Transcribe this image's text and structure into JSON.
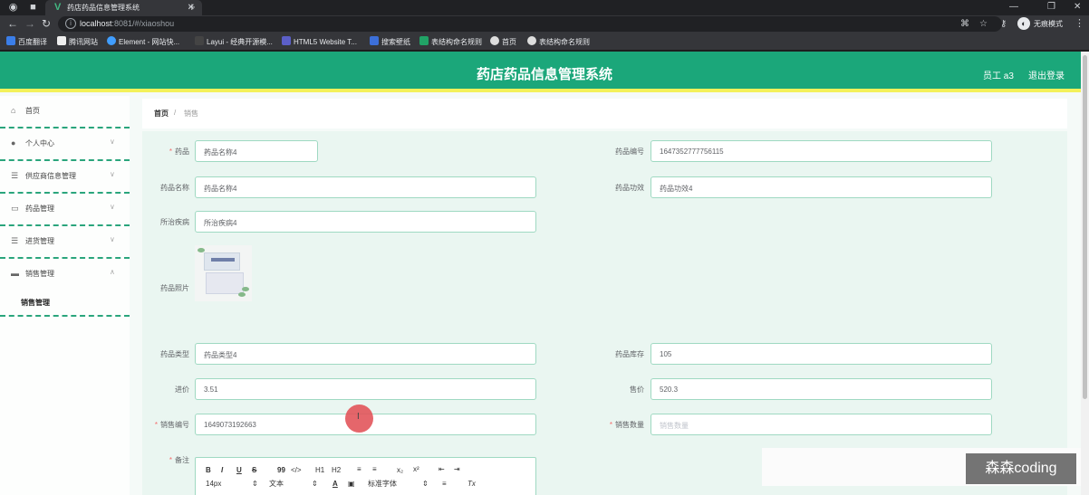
{
  "browser": {
    "tab_title": "药店药品信息管理系统",
    "tab_favicon": "vue-logo-icon",
    "url_host": "localhost",
    "url_rest": ":8081/#/xiaoshou",
    "profile_label": "无痕模式",
    "bookmarks": [
      "百度翻译",
      "腾讯网站",
      "Element - 网站快...",
      "Layui - 经典开源模...",
      "HTML5 Website T...",
      "搜索壁纸",
      "表结构命名规则",
      "首页",
      "表结构命名规则"
    ]
  },
  "header": {
    "title": "药店药品信息管理系统",
    "user": "员工 a3",
    "logout": "退出登录",
    "accent_color": "#1ba77a"
  },
  "sidebar": {
    "items": [
      {
        "label": "首页",
        "icon": "home-icon"
      },
      {
        "label": "个人中心",
        "icon": "user-icon"
      },
      {
        "label": "供应商信息管理",
        "icon": "list-icon"
      },
      {
        "label": "药品管理",
        "icon": "chat-icon"
      },
      {
        "label": "进货管理",
        "icon": "list-icon"
      },
      {
        "label": "销售管理",
        "icon": "card-icon"
      }
    ],
    "submenu_label": "销售管理"
  },
  "breadcrumb": {
    "home": "首页",
    "current": "销售"
  },
  "form": {
    "drug_select_label": "药品",
    "drug_select_value": "药品名称4",
    "drug_code_label": "药品编号",
    "drug_code_value": "1647352777756115",
    "drug_name_label": "药品名称",
    "drug_name_value": "药品名称4",
    "drug_effect_label": "药品功效",
    "drug_effect_value": "药品功效4",
    "disease_label": "所治疾病",
    "disease_value": "所治疾病4",
    "image_label": "药品照片",
    "drug_type_label": "药品类型",
    "drug_type_value": "药品类型4",
    "stock_label": "药品库存",
    "stock_value": "105",
    "purchase_price_label": "进价",
    "purchase_price_value": "3.51",
    "sale_price_label": "售价",
    "sale_price_value": "520.3",
    "sale_no_label": "销售编号",
    "sale_no_value": "1649073192663",
    "sale_qty_label": "销售数量",
    "sale_qty_placeholder": "销售数量",
    "remark_label": "备注"
  },
  "editor": {
    "tools_row1": [
      "B",
      "I",
      "U",
      "S",
      "99",
      "</>",
      "H1",
      "H2",
      "≡",
      "≡",
      "x₂",
      "x²",
      "⇤",
      "⇥"
    ],
    "font_size": "14px",
    "text_style": "文本",
    "font_family": "标准字体",
    "clear": "Tx"
  },
  "cursor_glyph": "I",
  "watermark": "森森coding"
}
